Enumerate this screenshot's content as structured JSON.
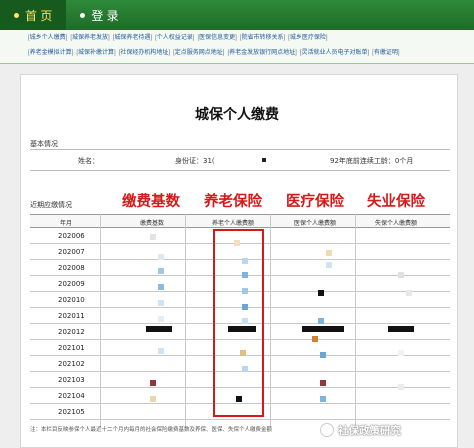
{
  "nav": {
    "home_label": "首 页",
    "login_label": "登 录"
  },
  "menu": {
    "row1": [
      "城乡个人缴费",
      "城保养老发放",
      "城保养老待遇",
      "个人权益记录",
      "医保信息变更",
      "院省市转移关系",
      "城乡医疗保险"
    ],
    "row2": [
      "养老金模拟计算",
      "城保补缴计算",
      "社保经办机构地址",
      "定点服务网点地址",
      "养老金发放银行网点地址",
      "灵活就业人员电子对账单",
      "有缴证明"
    ]
  },
  "page": {
    "title": "城保个人缴费"
  },
  "basic_info": {
    "section_label": "基本情况",
    "name_label": "姓名：",
    "id_label": "身份证：31(",
    "years_label": "92年底前连续工龄：0个月"
  },
  "recent": {
    "section_label": "近期应缴情况"
  },
  "annotations": {
    "base": "缴费基数",
    "pension": "养老保险",
    "medical": "医疗保险",
    "unemployment": "失业保险"
  },
  "table": {
    "headers": [
      "年月",
      "缴费基数",
      "养老个人缴费额",
      "医保个人缴费额",
      "失保个人缴费额"
    ],
    "rows": [
      "202006",
      "202007",
      "202008",
      "202009",
      "202010",
      "202011",
      "202012",
      "202101",
      "202102",
      "202103",
      "202104",
      "202105"
    ]
  },
  "footer": {
    "note": "注：本栏目反映参保个人最近十二个月内每月的社会保险缴费基数及养保、医保、失保个人缴费金额"
  },
  "watermark": {
    "text": "社保政策研究"
  },
  "colors": {
    "nav_green": "#1f6b28",
    "highlight_red": "#d41a1a",
    "link_blue": "#1f5a9c"
  }
}
